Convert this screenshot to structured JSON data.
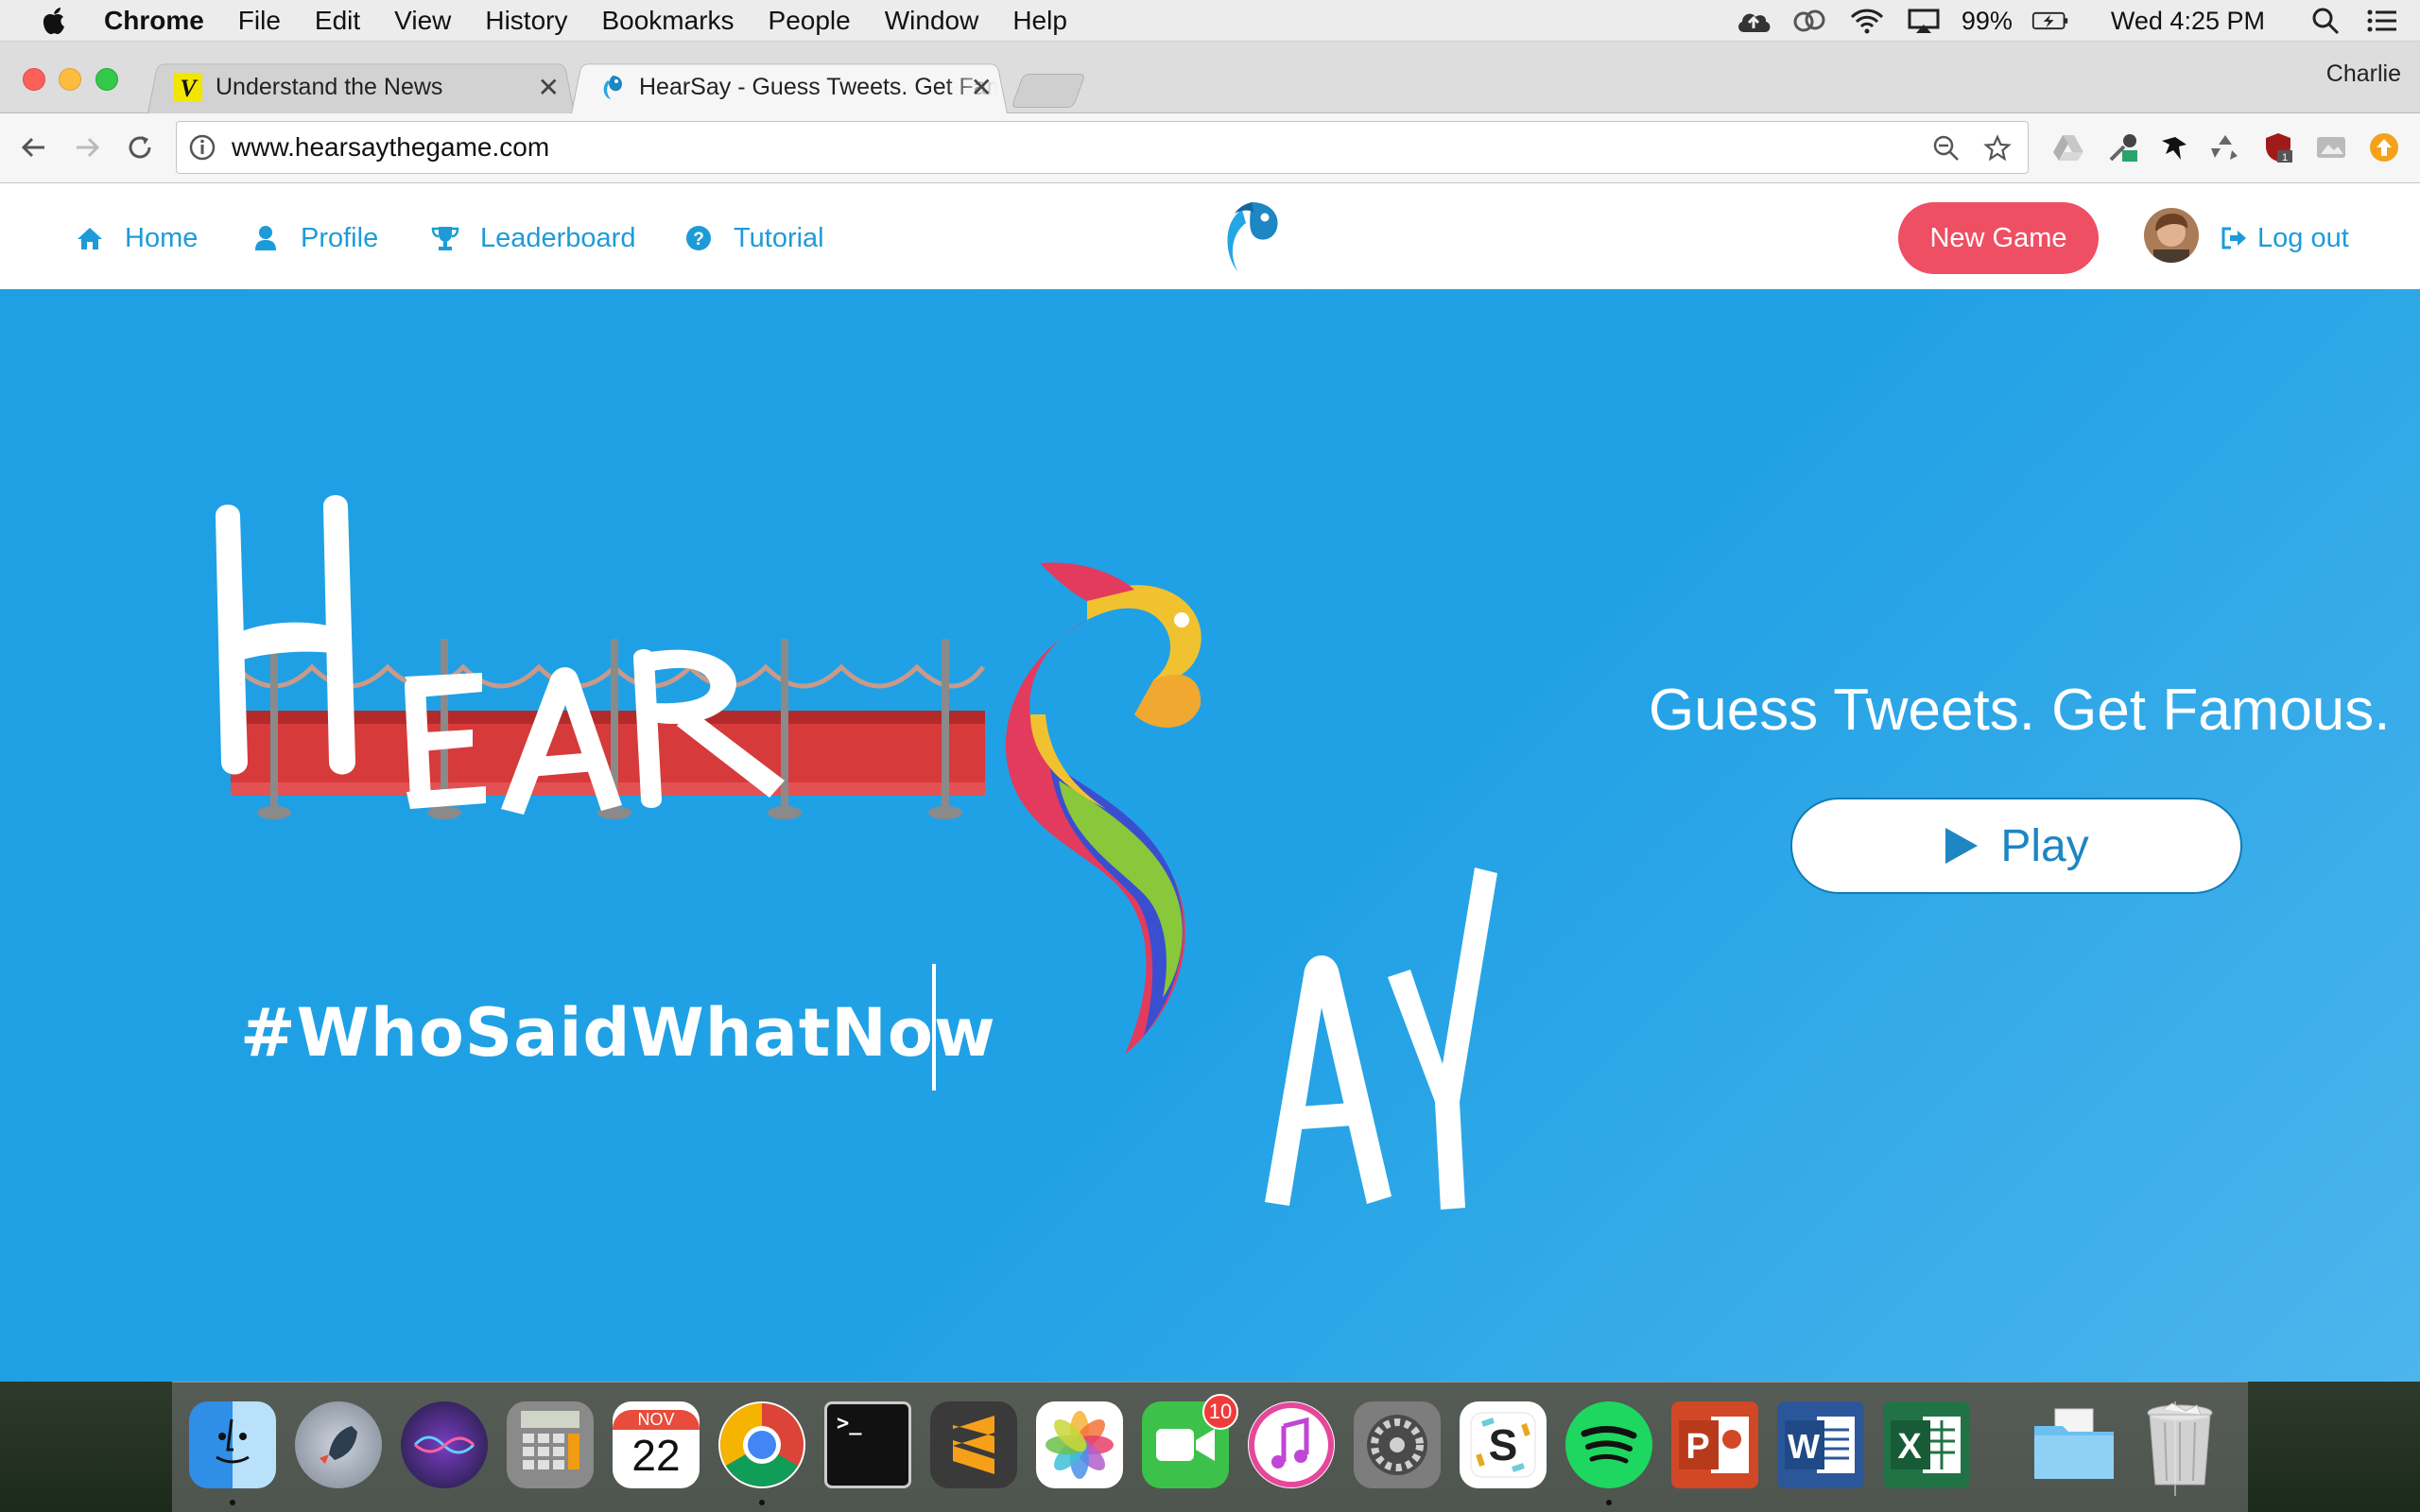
{
  "menubar": {
    "app_name": "Chrome",
    "items": [
      "File",
      "Edit",
      "View",
      "History",
      "Bookmarks",
      "People",
      "Window",
      "Help"
    ],
    "battery": "99%",
    "clock": "Wed 4:25 PM"
  },
  "browser": {
    "tabs": [
      {
        "title": "Understand the News",
        "favicon": "vox-v-icon",
        "active": false
      },
      {
        "title": "HearSay - Guess Tweets. Get Famous",
        "favicon": "hearsay-parrot-icon",
        "active": true
      }
    ],
    "profile_name": "Charlie",
    "url": "www.hearsaythegame.com"
  },
  "site": {
    "nav": {
      "home": "Home",
      "profile": "Profile",
      "leaderboard": "Leaderboard",
      "tutorial": "Tutorial",
      "new_game": "New Game",
      "logout": "Log out"
    },
    "hero": {
      "logo_words": [
        "HEAR",
        "AY"
      ],
      "hashtag": "#WhoSaidWhatNow",
      "slogan": "Guess Tweets. Get Famous.",
      "play_label": "Play"
    },
    "colors": {
      "brand_blue": "#1fa0e4",
      "link_blue": "#1d9bd9",
      "new_game_red": "#ee4f63"
    }
  },
  "dock": {
    "apps": [
      {
        "name": "Finder",
        "running": true
      },
      {
        "name": "Launchpad",
        "running": false
      },
      {
        "name": "Siri",
        "running": false
      },
      {
        "name": "Calculator",
        "running": false
      },
      {
        "name": "Calendar",
        "month": "NOV",
        "day": "22",
        "running": false
      },
      {
        "name": "Chrome",
        "running": true
      },
      {
        "name": "Terminal",
        "running": false
      },
      {
        "name": "Sublime Text",
        "running": false
      },
      {
        "name": "Photos",
        "running": false
      },
      {
        "name": "FaceTime",
        "badge": "10",
        "running": false
      },
      {
        "name": "iTunes",
        "running": false
      },
      {
        "name": "System Preferences",
        "running": false
      },
      {
        "name": "Slack",
        "running": false
      },
      {
        "name": "Spotify",
        "running": true
      },
      {
        "name": "PowerPoint",
        "running": false
      },
      {
        "name": "Word",
        "running": false
      },
      {
        "name": "Excel",
        "running": false
      },
      {
        "name": "Downloads",
        "running": false
      },
      {
        "name": "Trash",
        "running": false
      }
    ]
  }
}
